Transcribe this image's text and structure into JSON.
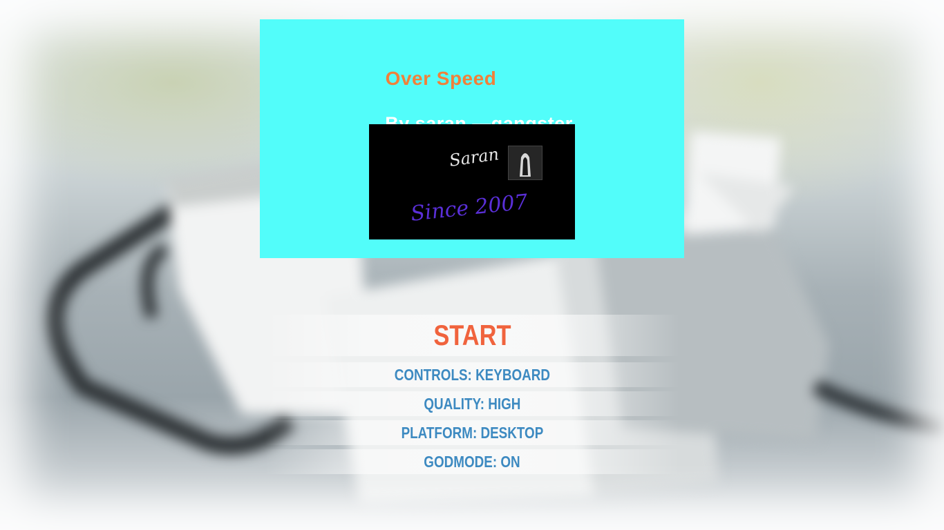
{
  "title_card": {
    "title": "Over Speed",
    "author": "By saran —gangster",
    "logo": {
      "name": "Saran",
      "since": "Since 2007"
    },
    "background_color": "#52fdfa"
  },
  "menu": {
    "start_label": "START",
    "options": {
      "controls": "CONTROLS: KEYBOARD",
      "quality": "QUALITY: HIGH",
      "platform": "PLATFORM: DESKTOP",
      "godmode": "GODMODE: ON"
    }
  },
  "colors": {
    "start": "#f0633d",
    "option": "#3d8ac1",
    "title": "#f0803a",
    "since": "#5a2fd8"
  }
}
